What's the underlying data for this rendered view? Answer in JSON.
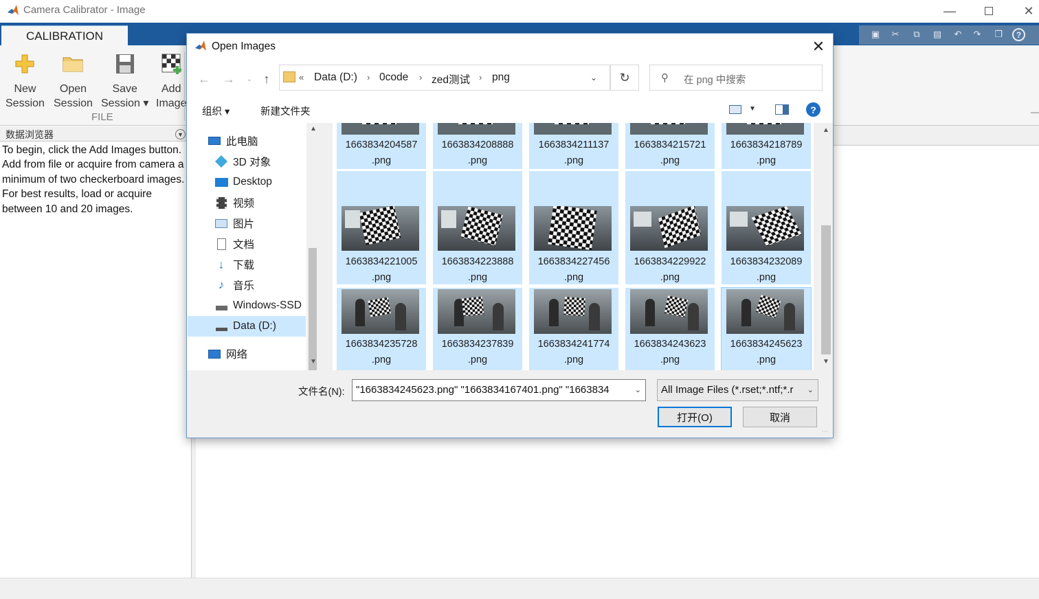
{
  "app": {
    "title": "Camera Calibrator - Image",
    "window_controls": [
      "minimize-icon",
      "maximize-icon",
      "close-icon"
    ]
  },
  "toolstrip": {
    "tab_label": "CALIBRATION",
    "buttons": [
      {
        "line1": "New",
        "line2": "Session",
        "icon": "plus-icon"
      },
      {
        "line1": "Open",
        "line2": "Session",
        "icon": "folder-icon"
      },
      {
        "line1": "Save",
        "line2": "Session ▾",
        "icon": "floppy-icon"
      },
      {
        "line1": "Add",
        "line2": "Image",
        "icon": "checkerboard-add-icon"
      }
    ],
    "section_label": "FILE"
  },
  "data_browser": {
    "title": "数据浏览器",
    "hint": "To begin, click the Add Images button. Add from file or acquire from camera a minimum of two checkerboard images. For best results, load or acquire between 10 and 20 images."
  },
  "dialog": {
    "title": "Open Images",
    "breadcrumb": [
      "«",
      "Data (D:)",
      "0code",
      "zed测试",
      "png"
    ],
    "search_placeholder": "在 png 中搜索",
    "organize_label": "组织 ▾",
    "new_folder_label": "新建文件夹",
    "nav_items": [
      {
        "label": "此电脑",
        "icon": "pc-icon"
      },
      {
        "label": "3D 对象",
        "icon": "cube-icon"
      },
      {
        "label": "Desktop",
        "icon": "desktop-icon"
      },
      {
        "label": "视频",
        "icon": "video-icon"
      },
      {
        "label": "图片",
        "icon": "pictures-icon"
      },
      {
        "label": "文档",
        "icon": "document-icon"
      },
      {
        "label": "下载",
        "icon": "download-icon"
      },
      {
        "label": "音乐",
        "icon": "music-icon"
      },
      {
        "label": "Windows-SSD",
        "icon": "drive-icon"
      },
      {
        "label": "Data (D:)",
        "icon": "drive-icon",
        "selected": true
      },
      {
        "label": "网络",
        "icon": "network-icon"
      }
    ],
    "files_top_row": [
      {
        "name": "1663834204587",
        "ext": ".png"
      },
      {
        "name": "1663834208888",
        "ext": ".png"
      },
      {
        "name": "1663834211137",
        "ext": ".png"
      },
      {
        "name": "1663834215721",
        "ext": ".png"
      },
      {
        "name": "1663834218789",
        "ext": ".png"
      }
    ],
    "files_mid_row": [
      {
        "name": "1663834221005",
        "ext": ".png"
      },
      {
        "name": "1663834223888",
        "ext": ".png"
      },
      {
        "name": "1663834227456",
        "ext": ".png"
      },
      {
        "name": "1663834229922",
        "ext": ".png"
      },
      {
        "name": "1663834232089",
        "ext": ".png"
      }
    ],
    "files_bottom_row": [
      {
        "name": "1663834235728",
        "ext": ".png"
      },
      {
        "name": "1663834237839",
        "ext": ".png"
      },
      {
        "name": "1663834241774",
        "ext": ".png"
      },
      {
        "name": "1663834243623",
        "ext": ".png"
      },
      {
        "name": "1663834245623",
        "ext": ".png"
      }
    ],
    "filename_label": "文件名(N):",
    "filename_value": "\"1663834245623.png\" \"1663834167401.png\" \"1663834",
    "filter_value": "All Image Files (*.rset;*.ntf;*.r",
    "open_label": "打开(O)",
    "cancel_label": "取消"
  },
  "colors": {
    "toolstrip_blue": "#1c5a9c",
    "selection": "#cce8ff",
    "accent": "#0078d7"
  }
}
